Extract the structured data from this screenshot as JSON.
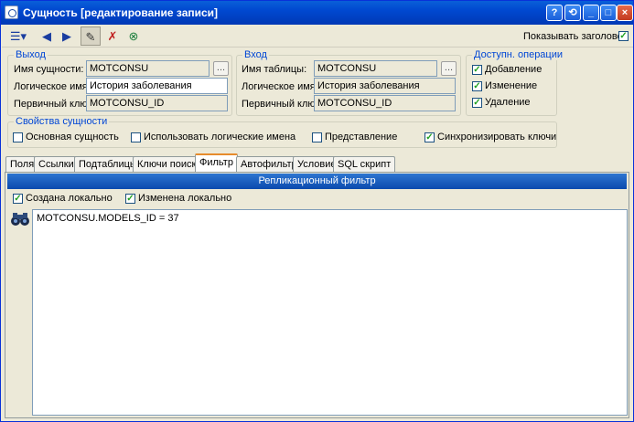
{
  "window": {
    "title": "Сущность [редактирование записи]",
    "controls": {
      "help": "?",
      "restore": "⟲",
      "minimize": "_",
      "maximize": "□",
      "close": "×"
    }
  },
  "toolbar": {
    "show_header_label": "Показывать заголовок",
    "show_header_checked": true,
    "tools": [
      {
        "name": "menu-grid-icon",
        "glyph": "☰▾"
      },
      {
        "name": "back-arrow-icon",
        "glyph": "◀"
      },
      {
        "name": "forward-arrow-icon",
        "glyph": "▶"
      },
      {
        "name": "edit-pencil-icon",
        "glyph": "✎"
      },
      {
        "name": "delete-record-icon",
        "glyph": "✗"
      },
      {
        "name": "cancel-record-icon",
        "glyph": "⊗"
      }
    ]
  },
  "output_group": {
    "title": "Выход",
    "entity_name_label": "Имя сущности:",
    "entity_name_value": "MOTCONSU",
    "logical_name_label": "Логическое имя:",
    "logical_name_value": "История заболевания",
    "primary_key_label": "Первичный ключ:",
    "primary_key_value": "MOTCONSU_ID",
    "ellipsis": "..."
  },
  "input_group": {
    "title": "Вход",
    "table_name_label": "Имя таблицы:",
    "table_name_value": "MOTCONSU",
    "logical_name_label": "Логическое имя:",
    "logical_name_value": "История заболевания",
    "primary_key_label": "Первичный ключ:",
    "primary_key_value": "MOTCONSU_ID",
    "ellipsis": "..."
  },
  "operations_group": {
    "title": "Доступн. операции",
    "items": [
      {
        "label": "Добавление",
        "checked": true
      },
      {
        "label": "Изменение",
        "checked": true
      },
      {
        "label": "Удаление",
        "checked": true
      }
    ]
  },
  "entity_props_group": {
    "title": "Свойства сущности",
    "items": [
      {
        "label": "Основная сущность",
        "checked": false
      },
      {
        "label": "Использовать логические имена",
        "checked": false
      },
      {
        "label": "Представление",
        "checked": false
      },
      {
        "label": "Синхронизировать ключи",
        "checked": true
      }
    ]
  },
  "tabs": [
    "Поля",
    "Ссылки",
    "Подтаблицы",
    "Ключи поиска",
    "Фильтр",
    "Автофильтр",
    "Условие",
    "SQL скрипт"
  ],
  "active_tab": "Фильтр",
  "filter_panel": {
    "banner": "Репликационный фильтр",
    "created_locally_label": "Создана локально",
    "created_locally_checked": true,
    "changed_locally_label": "Изменена локально",
    "changed_locally_checked": true,
    "expression": "MOTCONSU.MODELS_ID = 37"
  },
  "colors": {
    "title_bar": "#0a5fd8",
    "group_title": "#0046d5",
    "banner": "#1a5fc4",
    "active_tab_accent": "#e68b2c",
    "check": "#21a121"
  }
}
